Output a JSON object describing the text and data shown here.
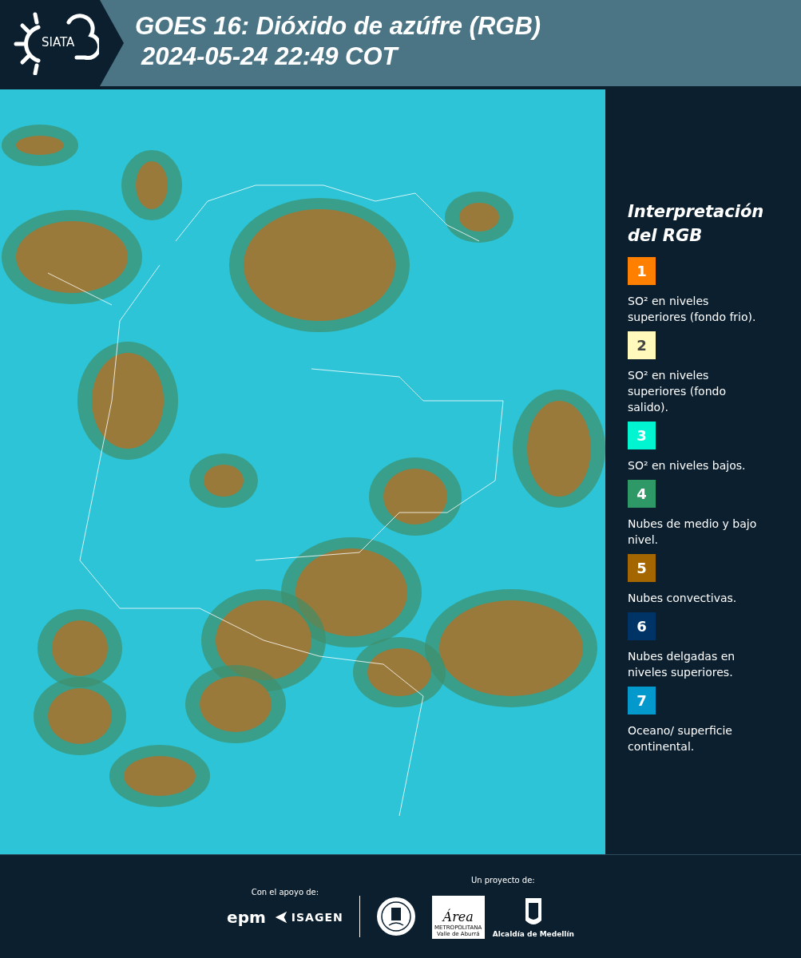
{
  "header": {
    "logo_text": "SIATA",
    "title": "GOES 16: Dióxido de azúfre (RGB)",
    "timestamp": "2024-05-24 22:49 COT"
  },
  "legend": {
    "title_line_1": "Interpretación",
    "title_line_2": "del RGB",
    "items": [
      {
        "number": "1",
        "color": "#ff7f00",
        "text": "SO² en niveles superiores (fondo frio)."
      },
      {
        "number": "2",
        "color": "#fff9bb",
        "text": "SO² en niveles superiores (fondo salido)."
      },
      {
        "number": "3",
        "color": "#00f5d0",
        "text": "SO² en niveles bajos."
      },
      {
        "number": "4",
        "color": "#2e9966",
        "text": "Nubes de medio y bajo nivel."
      },
      {
        "number": "5",
        "color": "#a36600",
        "text": "Nubes convectivas."
      },
      {
        "number": "6",
        "color": "#003366",
        "text": "Nubes delgadas en niveles superiores."
      },
      {
        "number": "7",
        "color": "#0399cc",
        "text": "Oceano/ superficie continental."
      }
    ]
  },
  "footer": {
    "support_label": "Con el apoyo de:",
    "support_logos": [
      "epm",
      "ISAGEN"
    ],
    "project_label": "Un proyecto de:",
    "area_logo": {
      "name": "Área",
      "subtitle_1": "METROPOLITANA",
      "subtitle_2": "Valle de Aburrá"
    },
    "city_logo_text": "Alcaldía de Medellín"
  }
}
